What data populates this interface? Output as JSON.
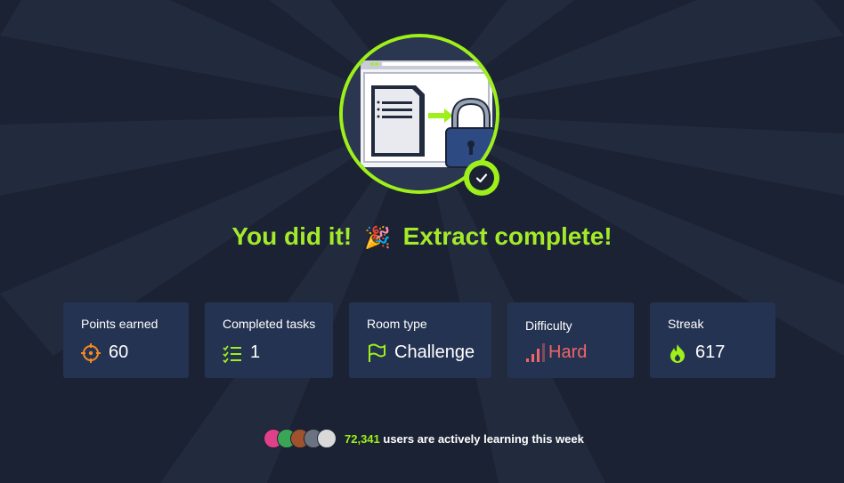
{
  "headline": {
    "part1": "You did it!",
    "emoji": "🎉",
    "part2": "Extract complete!"
  },
  "stats": [
    {
      "label": "Points earned",
      "value": "60",
      "icon": "crosshair-icon"
    },
    {
      "label": "Completed tasks",
      "value": "1",
      "icon": "checklist-icon"
    },
    {
      "label": "Room type",
      "value": "Challenge",
      "icon": "flag-icon"
    },
    {
      "label": "Difficulty",
      "value": "Hard",
      "icon": "signal-bars-icon"
    },
    {
      "label": "Streak",
      "value": "617",
      "icon": "flame-icon"
    }
  ],
  "footer": {
    "count": "72,341",
    "text": "users are actively learning this week"
  },
  "colors": {
    "accent": "#9ef01a",
    "background": "#1b2233",
    "card": "#253352",
    "hard": "#f0646a",
    "points_icon": "#f58b1f"
  }
}
